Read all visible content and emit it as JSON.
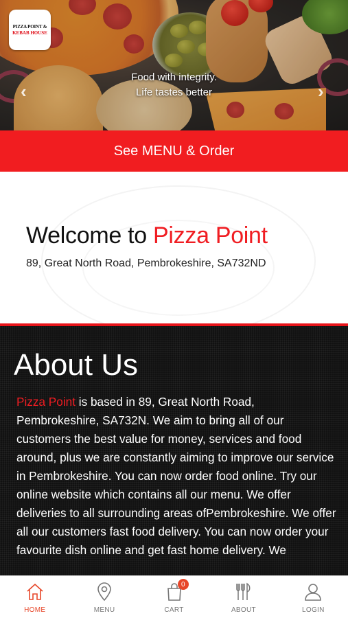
{
  "hero": {
    "logo_line1": "PIZZA POINT &",
    "logo_line2": "KEBAB HOUSE",
    "tagline_line1": "Food with integrity.",
    "tagline_line2": "Life tastes better",
    "prev_arrow": "‹",
    "next_arrow": "›"
  },
  "order_button": {
    "label": "See MENU & Order"
  },
  "welcome": {
    "prefix": "Welcome to ",
    "brand": "Pizza Point",
    "address": "89, Great North Road, Pembrokeshire, SA732ND"
  },
  "about": {
    "title": "About Us",
    "brand": "Pizza Point",
    "body": " is based in 89, Great North Road, Pembrokeshire, SA732N. We aim to bring all of our customers the best value for money, services and food around, plus we are constantly aiming to improve our service in Pembrokeshire. You can now order food online. Try our online website which contains all our menu. We offer deliveries to all surrounding areas ofPembrokeshire. We offer all our customers fast food delivery. You can now order your favourite dish online and get fast home delivery. We"
  },
  "bottom_nav": {
    "items": [
      {
        "label": "HOME",
        "icon": "home-icon",
        "active": true
      },
      {
        "label": "MENU",
        "icon": "location-pin-icon",
        "active": false
      },
      {
        "label": "CART",
        "icon": "shopping-bag-icon",
        "active": false
      },
      {
        "label": "ABOUT",
        "icon": "cutlery-icon",
        "active": false
      },
      {
        "label": "LOGIN",
        "icon": "user-icon",
        "active": false
      }
    ],
    "cart_count": "0"
  },
  "colors": {
    "accent_red": "#f11d20",
    "nav_active": "#e7472a"
  }
}
